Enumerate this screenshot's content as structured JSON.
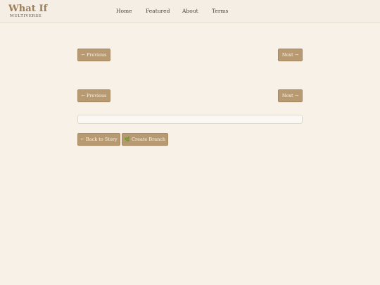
{
  "header": {
    "brand_title": "What If",
    "brand_subtitle": "MULTIVERSE",
    "nav": [
      "Home",
      "Featured",
      "About",
      "Terms"
    ]
  },
  "pager_top": {
    "previous_label": "← Previous",
    "next_label": "Next →"
  },
  "pager_bottom": {
    "previous_label": "← Previous",
    "next_label": "Next →"
  },
  "input": {
    "value": "",
    "placeholder": ""
  },
  "actions": {
    "back_label": "← Back to Story",
    "create_branch_label": "🌿 Create Branch"
  }
}
